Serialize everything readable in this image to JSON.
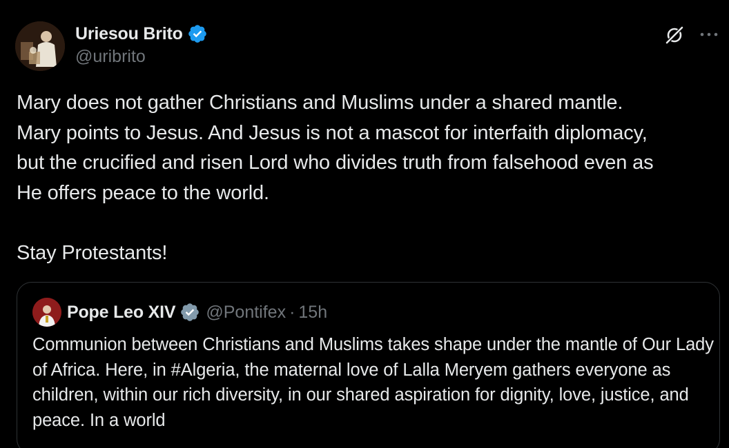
{
  "author": {
    "display_name": "Uriesou Brito",
    "handle": "@uribrito",
    "avatar_icon": "user-avatar",
    "verified_icon": "verified-badge-icon",
    "verified_color": "#1d9bf0"
  },
  "toolbar": {
    "grok_icon": "grok-icon",
    "more_icon": "more-options-icon"
  },
  "tweet": {
    "text": "Mary does not gather Christians and Muslims under a shared mantle.\nMary points to Jesus. And Jesus is not a mascot for interfaith diplomacy,\nbut the crucified and risen Lord who divides truth from falsehood even as\nHe offers peace to the world.\n\nStay Protestants!"
  },
  "quoted": {
    "display_name": "Pope Leo XIV",
    "handle": "@Pontifex",
    "separator": "·",
    "time": "15h",
    "badge_icon": "gray-verified-badge-icon",
    "badge_color": "#829aab",
    "text": "Communion between Christians and Muslims takes shape under the mantle of Our Lady of Africa. Here, in #Algeria, the maternal love of Lalla Meryem gathers everyone as children, within our rich diversity, in our shared aspiration for dignity, love, justice, and peace. In a world"
  },
  "colors": {
    "background": "#000000",
    "primary_text": "#e7e9ea",
    "secondary_text": "#71767b",
    "border": "#2f3336"
  }
}
